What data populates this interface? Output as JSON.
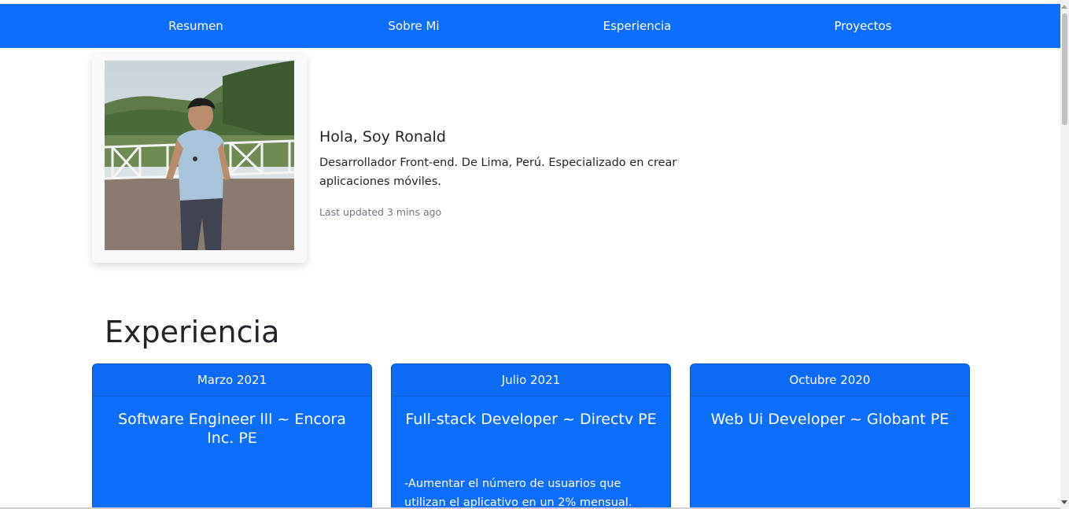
{
  "nav": {
    "items": [
      {
        "label": "Resumen"
      },
      {
        "label": "Sobre Mi"
      },
      {
        "label": "Esperiencia"
      },
      {
        "label": "Proyectos"
      }
    ]
  },
  "profile": {
    "name": "Hola, Soy Ronald",
    "description": "Desarrollador Front-end. De Lima, Perú. Especializado en crear aplicaciones móviles.",
    "updated": "Last updated 3 mins ago"
  },
  "experience": {
    "title": "Experiencia",
    "cards": [
      {
        "date": "Marzo 2021",
        "role": "Software Engineer lll ~ Encora Inc. PE",
        "description": ""
      },
      {
        "date": "Julio 2021",
        "role": "Full-stack Developer ~ Directv PE",
        "description": "-Aumentar el número de usuarios que utilizan el aplicativo en un 2% mensual."
      },
      {
        "date": "Octubre 2020",
        "role": "Web Ui Developer ~ Globant PE",
        "description": ""
      }
    ]
  },
  "colors": {
    "primary": "#0d6efd",
    "text": "#212529",
    "muted": "#6c757d"
  }
}
